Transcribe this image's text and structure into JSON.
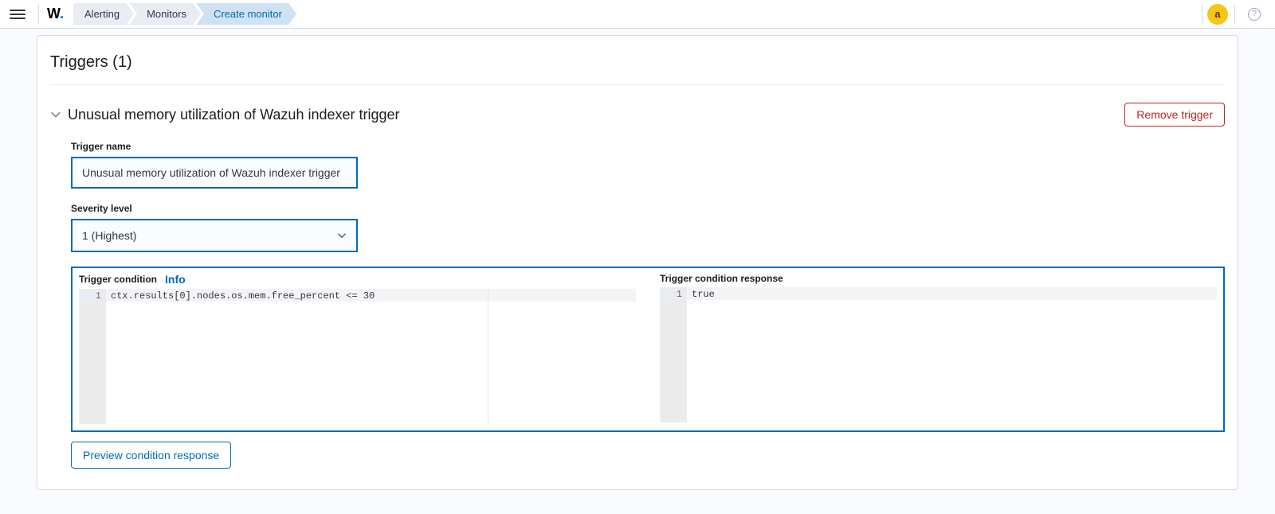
{
  "header": {
    "logo_text": "W",
    "breadcrumbs": [
      {
        "label": "Alerting",
        "active": false
      },
      {
        "label": "Monitors",
        "active": false
      },
      {
        "label": "Create monitor",
        "active": true
      }
    ],
    "avatar_initial": "a"
  },
  "section": {
    "title": "Triggers (1)"
  },
  "trigger": {
    "title": "Unusual memory utilization of Wazuh indexer trigger",
    "remove_label": "Remove trigger",
    "name_label": "Trigger name",
    "name_value": "Unusual memory utilization of Wazuh indexer trigger",
    "severity_label": "Severity level",
    "severity_value": "1 (Highest)",
    "condition_label": "Trigger condition",
    "condition_info": "Info",
    "condition_code": "ctx.results[0].nodes.os.mem.free_percent <= 30",
    "condition_line_no": "1",
    "response_label": "Trigger condition response",
    "response_code": "true",
    "response_line_no": "1",
    "preview_label": "Preview condition response"
  }
}
